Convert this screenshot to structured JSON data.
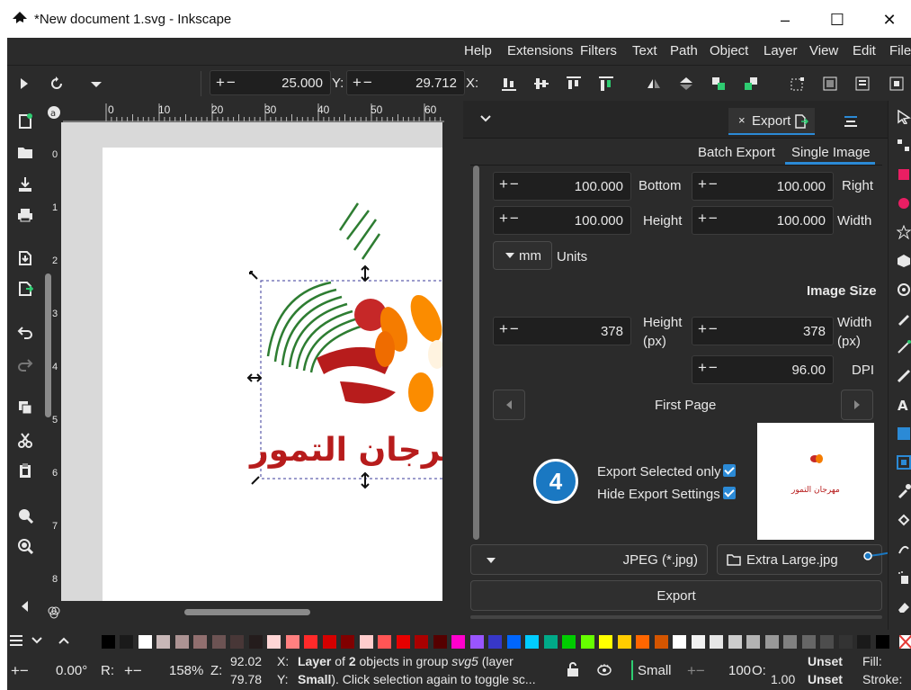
{
  "window": {
    "title": "*New document 1.svg - Inkscape",
    "minimize": "–",
    "maximize": "☐",
    "close": "✕"
  },
  "menu": [
    "Help",
    "Extensions",
    "Filters",
    "Text",
    "Path",
    "Object",
    "Layer",
    "View",
    "Edit",
    "File"
  ],
  "toolctrl": {
    "spin1_value": "25.000",
    "y_label": "Y:",
    "spin2_value": "29.712",
    "x_label": "X:"
  },
  "ruler_labels": [
    "0",
    "10",
    "20",
    "30",
    "40",
    "50",
    "60"
  ],
  "ruler_v_labels": [
    "0",
    "1",
    "2",
    "3",
    "4",
    "5",
    "6",
    "7",
    "8"
  ],
  "canvas_text": "مهرجان التمور",
  "export": {
    "tab_close": "×",
    "tab_label": "Export",
    "subtabs": [
      "Batch Export",
      "Single Image"
    ],
    "rows": [
      {
        "left_value": "100.000",
        "mid_label": "Bottom",
        "right_value": "100.000",
        "right_label": "Right"
      },
      {
        "left_value": "100.000",
        "mid_label": "Height",
        "right_value": "100.000",
        "right_label": "Width"
      }
    ],
    "units_value": "mm",
    "units_label": "Units",
    "image_size_heading": "Image Size",
    "px_left_value": "378",
    "px_left_label_1": "Height",
    "px_left_label_2": "(px)",
    "px_right_value": "378",
    "px_right_label_1": "Width",
    "px_right_label_2": "(px)",
    "dpi_value": "96.00",
    "dpi_label": "DPI",
    "page_nav_label": "First Page",
    "export_selected_only": "Export Selected only",
    "hide_export_settings": "Hide Export Settings",
    "preview_text": "مهرجان التمور",
    "format": "JPEG (*.jpg)",
    "filename": "Extra Large.jpg",
    "export_button": "Export"
  },
  "callout_number": "4",
  "status": {
    "rotation": "0.00°",
    "r_label": "R:",
    "zoom": "158%",
    "z_label": "Z:",
    "x_coord": "92.02",
    "y_coord": "79.78",
    "x_label": "X:",
    "y_label": "Y:",
    "msg_line1_a": "Layer",
    "msg_line1_b": " of ",
    "msg_line1_c": "2",
    "msg_line1_d": " objects in group ",
    "msg_line1_e": "svg5",
    "msg_line1_f": " (layer",
    "msg_line2_a": "Small",
    "msg_line2_b": "). Click selection again to toggle sc...",
    "layer_name": "Small",
    "opacity_value": "100",
    "o_label": "O:",
    "stroke_width": "1.00",
    "fill_label": "Fill:",
    "fill_value": "Unset",
    "stroke_label": "Stroke:",
    "stroke_value": "Unset"
  },
  "palette": [
    "#2b2b2b",
    "#000000",
    "#1a1a1a",
    "#ffffff",
    "#c8b7b7",
    "#ac9393",
    "#916f6f",
    "#6c5353",
    "#483737",
    "#241c1c",
    "#ffd5d5",
    "#ff8080",
    "#ff2a2a",
    "#d40000",
    "#800000",
    "#ffcccc",
    "#ff5555",
    "#e60000",
    "#aa0000",
    "#550000",
    "#ff00cc",
    "#9955ff",
    "#3737c8",
    "#0066ff",
    "#00ccff",
    "#00aa88",
    "#00cc00",
    "#66ff00",
    "#ffff00",
    "#ffcc00",
    "#ff6600",
    "#d45500",
    "#ffffff",
    "#f2f2f2",
    "#e6e6e6",
    "#cccccc",
    "#b3b3b3",
    "#999999",
    "#808080",
    "#666666",
    "#4d4d4d",
    "#333333",
    "#1a1a1a",
    "#000000"
  ]
}
